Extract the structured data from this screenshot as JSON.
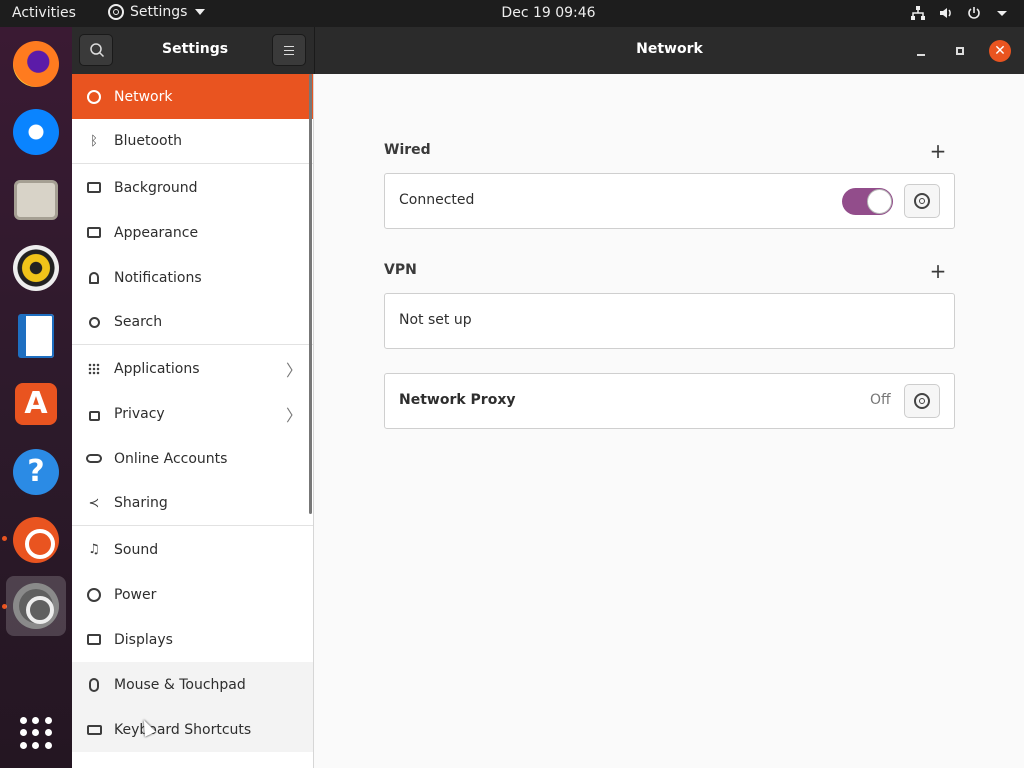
{
  "topbar": {
    "activities": "Activities",
    "app_menu": "Settings",
    "clock": "Dec 19  09:46",
    "tray_icons": [
      "network-icon",
      "volume-icon",
      "power-icon",
      "chevron-down-icon"
    ]
  },
  "dock": {
    "apps": [
      "Firefox",
      "Thunderbird",
      "Files",
      "Rhythmbox",
      "LibreOffice Writer",
      "Ubuntu Software",
      "Help",
      "Ubuntu",
      "Settings"
    ]
  },
  "header": {
    "left_title": "Settings",
    "main_title": "Network"
  },
  "sidebar": {
    "items": [
      {
        "label": "Network",
        "icon": "network-icon"
      },
      {
        "label": "Bluetooth",
        "icon": "bluetooth-icon"
      },
      {
        "label": "Background",
        "icon": "background-icon"
      },
      {
        "label": "Appearance",
        "icon": "appearance-icon"
      },
      {
        "label": "Notifications",
        "icon": "bell-icon"
      },
      {
        "label": "Search",
        "icon": "search-icon"
      },
      {
        "label": "Applications",
        "icon": "grid-icon"
      },
      {
        "label": "Privacy",
        "icon": "lock-icon"
      },
      {
        "label": "Online Accounts",
        "icon": "cloud-icon"
      },
      {
        "label": "Sharing",
        "icon": "share-icon"
      },
      {
        "label": "Sound",
        "icon": "music-icon"
      },
      {
        "label": "Power",
        "icon": "power-icon"
      },
      {
        "label": "Displays",
        "icon": "display-icon"
      },
      {
        "label": "Mouse & Touchpad",
        "icon": "mouse-icon"
      },
      {
        "label": "Keyboard Shortcuts",
        "icon": "keyboard-icon"
      }
    ]
  },
  "content": {
    "wired": {
      "title": "Wired",
      "status": "Connected",
      "toggle_on": true
    },
    "vpn": {
      "title": "VPN",
      "status": "Not set up"
    },
    "proxy": {
      "title": "Network Proxy",
      "status": "Off"
    }
  },
  "colors": {
    "accent": "#e95420",
    "toggle": "#924d8b",
    "header_bg": "#2b2b2b"
  }
}
